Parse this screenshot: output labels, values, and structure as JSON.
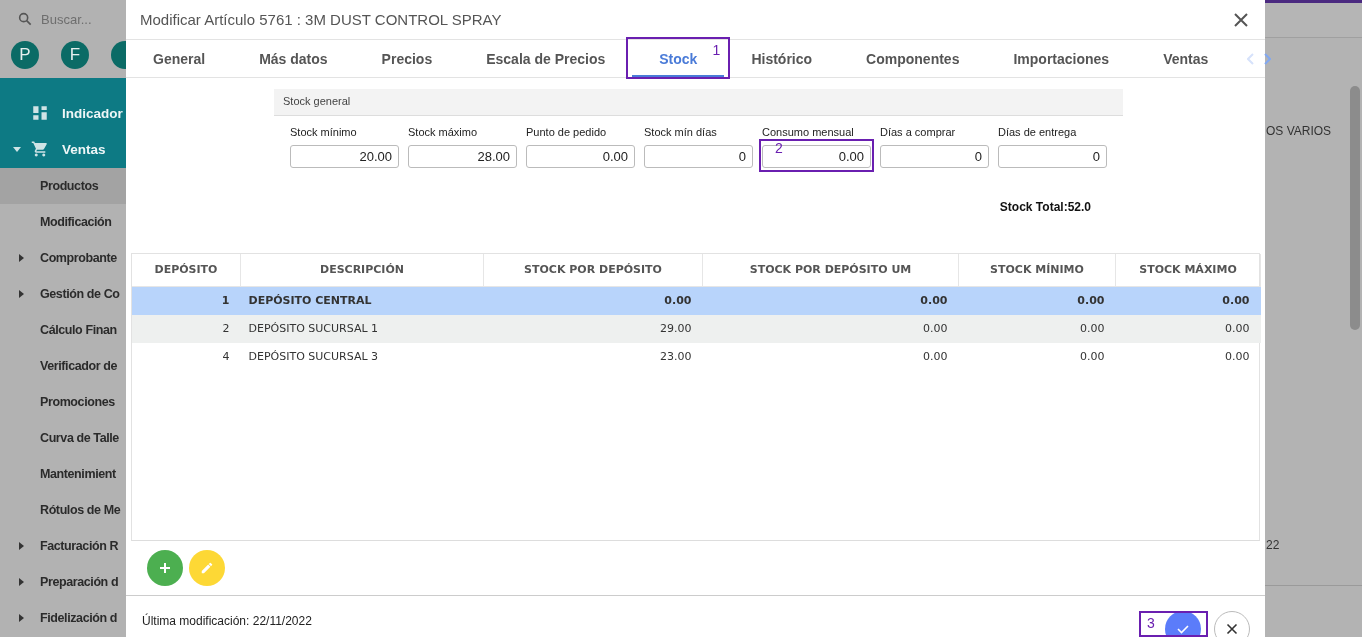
{
  "sidebar": {
    "search": {
      "placeholder": "Buscar..."
    },
    "avatars": [
      {
        "letter": "P"
      },
      {
        "letter": "F"
      }
    ],
    "modules": [
      {
        "label": "Indicador",
        "kind": "link"
      },
      {
        "label": "Ventas",
        "kind": "group",
        "expanded": true
      }
    ],
    "items": [
      {
        "label": "Productos",
        "kind": "link",
        "selected": true
      },
      {
        "label": "Modificación",
        "kind": "link",
        "selected": false
      },
      {
        "label": "Comprobante",
        "kind": "group",
        "selected": false
      },
      {
        "label": "Gestión de Co",
        "kind": "group",
        "selected": false
      },
      {
        "label": "Cálculo Finan",
        "kind": "link",
        "selected": false
      },
      {
        "label": "Verificador de",
        "kind": "link",
        "selected": false
      },
      {
        "label": "Promociones",
        "kind": "link",
        "selected": false
      },
      {
        "label": "Curva de Talle",
        "kind": "link",
        "selected": false
      },
      {
        "label": "Mantenimient",
        "kind": "link",
        "selected": false
      },
      {
        "label": "Rótulos de Me",
        "kind": "link",
        "selected": false
      },
      {
        "label": "Facturación R",
        "kind": "group",
        "selected": false
      },
      {
        "label": "Preparación d",
        "kind": "group",
        "selected": false
      },
      {
        "label": "Fidelización d",
        "kind": "group",
        "selected": false
      }
    ]
  },
  "background": {
    "fragments": [
      "OS VARIOS",
      "22"
    ]
  },
  "modal": {
    "title": "Modificar Artículo 5761 : 3M DUST CONTROL SPRAY",
    "tabs": [
      {
        "label": "General",
        "selected": false
      },
      {
        "label": "Más datos",
        "selected": false
      },
      {
        "label": "Precios",
        "selected": false
      },
      {
        "label": "Escala de Precios",
        "selected": false
      },
      {
        "label": "Stock",
        "selected": true,
        "annotation": "1"
      },
      {
        "label": "Histórico",
        "selected": false
      },
      {
        "label": "Componentes",
        "selected": false
      },
      {
        "label": "Importaciones",
        "selected": false
      },
      {
        "label": "Ventas",
        "selected": false
      }
    ],
    "section_title": "Stock general",
    "fields": [
      {
        "label": "Stock mínimo",
        "value": "20.00"
      },
      {
        "label": "Stock máximo",
        "value": "28.00"
      },
      {
        "label": "Punto de pedido",
        "value": "0.00"
      },
      {
        "label": "Stock mín días",
        "value": "0"
      },
      {
        "label": "Consumo mensual",
        "value": "0.00",
        "annotation": "2"
      },
      {
        "label": "Días a comprar",
        "value": "0"
      },
      {
        "label": "Días de entrega",
        "value": "0"
      }
    ],
    "stock_total": "Stock Total:52.0",
    "table": {
      "columns": [
        "DEPÓSITO",
        "DESCRIPCIÓN",
        "STOCK POR DEPÓSITO",
        "STOCK POR DEPÓSITO UM",
        "STOCK MÍNIMO",
        "STOCK MÁXIMO"
      ],
      "rows": [
        {
          "selected": true,
          "cells": [
            "1",
            "DEPÓSITO CENTRAL",
            "0.00",
            "0.00",
            "0.00",
            "0.00"
          ]
        },
        {
          "selected": false,
          "cells": [
            "2",
            "DEPÓSITO SUCURSAL 1",
            "29.00",
            "0.00",
            "0.00",
            "0.00"
          ]
        },
        {
          "selected": false,
          "cells": [
            "4",
            "DEPÓSITO SUCURSAL 3",
            "23.00",
            "0.00",
            "0.00",
            "0.00"
          ]
        }
      ]
    },
    "footer": {
      "last_modified": "Última modificación: 22/11/2022",
      "confirm_annotation": "3"
    }
  }
}
